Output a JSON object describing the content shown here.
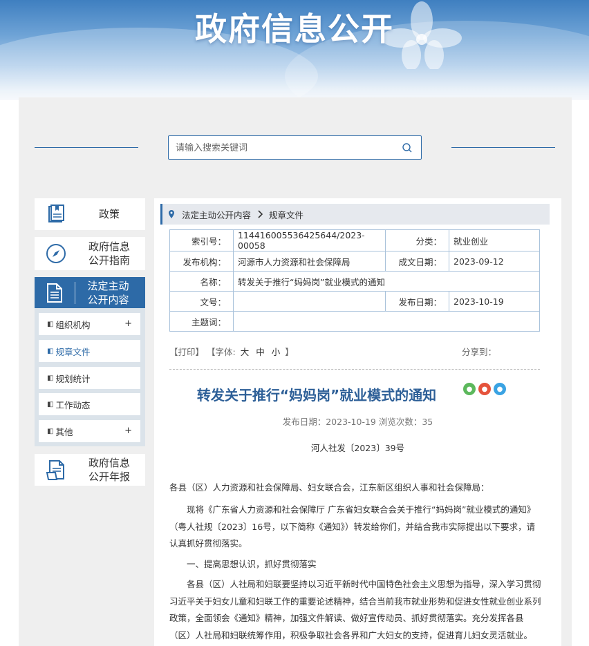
{
  "banner": {
    "title": "政府信息公开"
  },
  "search": {
    "placeholder": "请输入搜索关键词"
  },
  "nav": {
    "items": [
      {
        "label": "政策",
        "icon": "book-icon"
      },
      {
        "label": "政府信息\n公开指南",
        "icon": "compass-icon"
      },
      {
        "label": "法定主动\n公开内容",
        "icon": "document-icon"
      },
      {
        "label": "政府信息\n公开年报",
        "icon": "report-icon"
      }
    ],
    "sub_items": [
      {
        "label": "组织机构",
        "plus": "+"
      },
      {
        "label": "规章文件",
        "plus": ""
      },
      {
        "label": "规划统计",
        "plus": ""
      },
      {
        "label": "工作动态",
        "plus": ""
      },
      {
        "label": "其他",
        "plus": "+"
      }
    ]
  },
  "breadcrumb": {
    "level1": "法定主动公开内容",
    "level2": "规章文件"
  },
  "meta": {
    "index_label": "索引号：",
    "index_value": "114416005536425644/2023-00058",
    "category_label": "分类：",
    "category_value": "就业创业",
    "org_label": "发布机构：",
    "org_value": "河源市人力资源和社会保障局",
    "created_label": "成文日期：",
    "created_value": "2023-09-12",
    "name_label": "名称：",
    "name_value": "转发关于推行“妈妈岗”就业模式的通知",
    "docno_label": "文号：",
    "docno_value": "",
    "published_label": "发布日期：",
    "published_value": "2023-10-19",
    "keywords_label": "主题词：",
    "keywords_value": ""
  },
  "toolbar": {
    "print": "【打印】",
    "font_prefix": "【字体:",
    "font_large": "大",
    "font_medium": "中",
    "font_small": "小",
    "font_suffix": "】",
    "share": "分享到："
  },
  "article": {
    "title": "转发关于推行“妈妈岗”就业模式的通知",
    "info": "发布日期：2023-10-19  浏览次数：35",
    "doc_no": "河人社发〔2023〕39号",
    "p1": "各县（区）人力资源和社会保障局、妇女联合会，江东新区组织人事和社会保障局：",
    "p2": "现将《广东省人力资源和社会保障厅 广东省妇女联合会关于推行“妈妈岗”就业模式的通知》（粤人社规〔2023〕16号，以下简称《通知》）转发给你们，并结合我市实际提出以下要求，请认真抓好贯彻落实。",
    "p3": "一、提高思想认识，抓好贯彻落实",
    "p4": "各县（区）人社局和妇联要坚持以习近平新时代中国特色社会主义思想为指导，深入学习贯彻习近平关于妇女儿童和妇联工作的重要论述精神，结合当前我市就业形势和促进女性就业创业系列政策，全面领会《通知》精神，加强文件解读、做好宣传动员、抓好贯彻落实。充分发挥各县（区）人社局和妇联统筹作用，积极争取社会各界和广大妇女的支持，促进育儿妇女灵活就业。"
  },
  "colors": {
    "primary": "#2d6aa7",
    "title": "#2d5f97",
    "panel": "#efefef"
  }
}
